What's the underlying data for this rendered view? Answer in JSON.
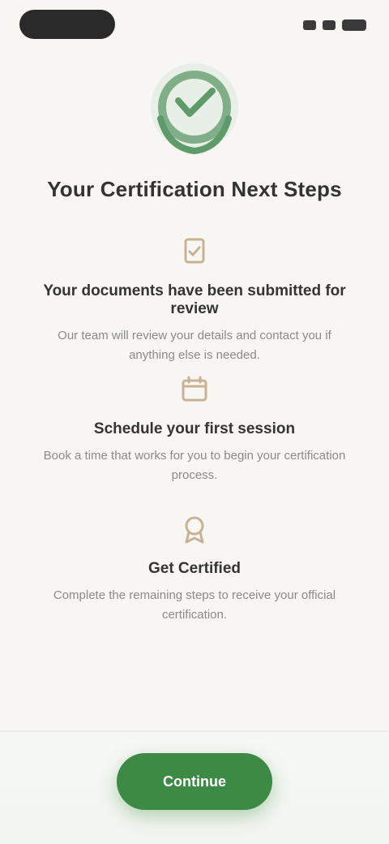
{
  "status_bar": {
    "time": ""
  },
  "emblem": {
    "icon": "laurel-wreath-icon",
    "color": "#5f9a6a"
  },
  "title": "Your Certification Next Steps",
  "steps": [
    {
      "icon": "document-check-icon",
      "heading": "Your documents have been submitted for review",
      "text": "Our team will review your details and contact you if anything else is needed."
    },
    {
      "icon": "calendar-icon",
      "heading": "Schedule your first session",
      "text": "Book a time that works for you to begin your certification process."
    },
    {
      "icon": "badge-icon",
      "heading": "Get Certified",
      "text": "Complete the remaining steps to receive your official certification."
    }
  ],
  "cta": {
    "label": "Continue"
  },
  "colors": {
    "accent": "#3d8a45",
    "background": "#f7f6f2",
    "icon_tan": "#c8b296"
  }
}
